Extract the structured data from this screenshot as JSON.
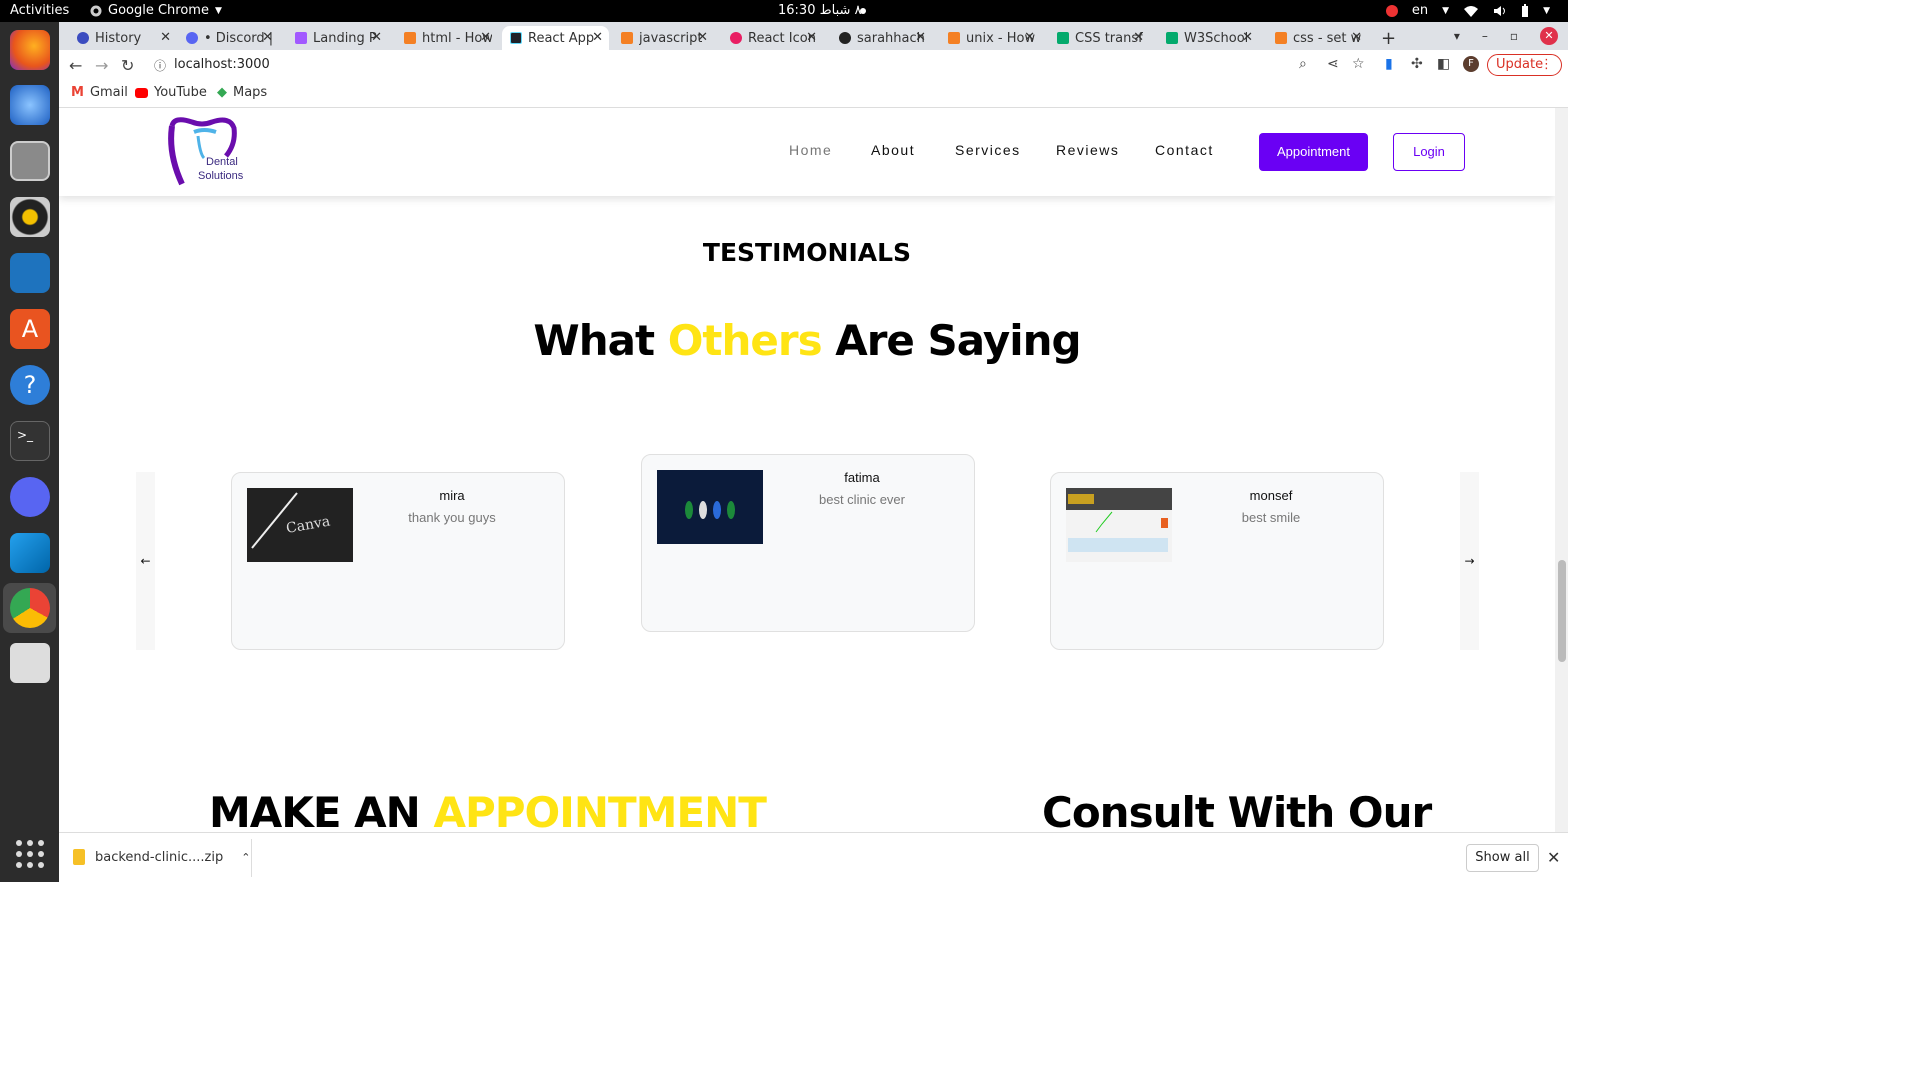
{
  "os": {
    "activities": "Activities",
    "app_name": "Google Chrome",
    "clock": "16:30 ٨ شباط",
    "lang": "en"
  },
  "browser": {
    "tabs": [
      {
        "label": "History",
        "color": "#3b4cc0"
      },
      {
        "label": "• Discord |",
        "color": "#5865f2"
      },
      {
        "label": "Landing P",
        "color": "#a259ff"
      },
      {
        "label": "html - How",
        "color": "#f48024"
      },
      {
        "label": "React App",
        "color": "#20232a"
      },
      {
        "label": "javascript",
        "color": "#f48024"
      },
      {
        "label": "React Icon",
        "color": "#e91e63"
      },
      {
        "label": "sarahhach",
        "color": "#222222"
      },
      {
        "label": "unix - How",
        "color": "#f48024"
      },
      {
        "label": "CSS transf",
        "color": "#04aa6d"
      },
      {
        "label": "W3School",
        "color": "#04aa6d"
      },
      {
        "label": "css - set w",
        "color": "#f48024"
      }
    ],
    "url": "localhost:3000",
    "update_label": "Update",
    "avatar_letter": "F",
    "bookmarks": [
      "Gmail",
      "YouTube",
      "Maps"
    ]
  },
  "site": {
    "logo_line1": "Dental",
    "logo_line2": "Solutions",
    "nav": [
      "Home",
      "About",
      "Services",
      "Reviews",
      "Contact"
    ],
    "appointment_button": "Appointment",
    "login_button": "Login",
    "section_label": "TESTIMONIALS",
    "heading_part1": "What ",
    "heading_highlight": "Others",
    "heading_part2": " Are Saying",
    "accent_color": "#ffe414",
    "brand_color": "#6a00f4",
    "testimonials": [
      {
        "name": "mira",
        "text": "thank you guys"
      },
      {
        "name": "fatima",
        "text": "best clinic ever"
      },
      {
        "name": "monsef",
        "text": "best smile"
      }
    ],
    "prev_arrow": "←",
    "next_arrow": "→",
    "appointment_heading_part1": "MAKE AN ",
    "appointment_heading_highlight": "APPOINTMENT",
    "consult_heading": "Consult With Our"
  },
  "downloads": {
    "file": "backend-clinic....zip",
    "show_all": "Show all"
  }
}
